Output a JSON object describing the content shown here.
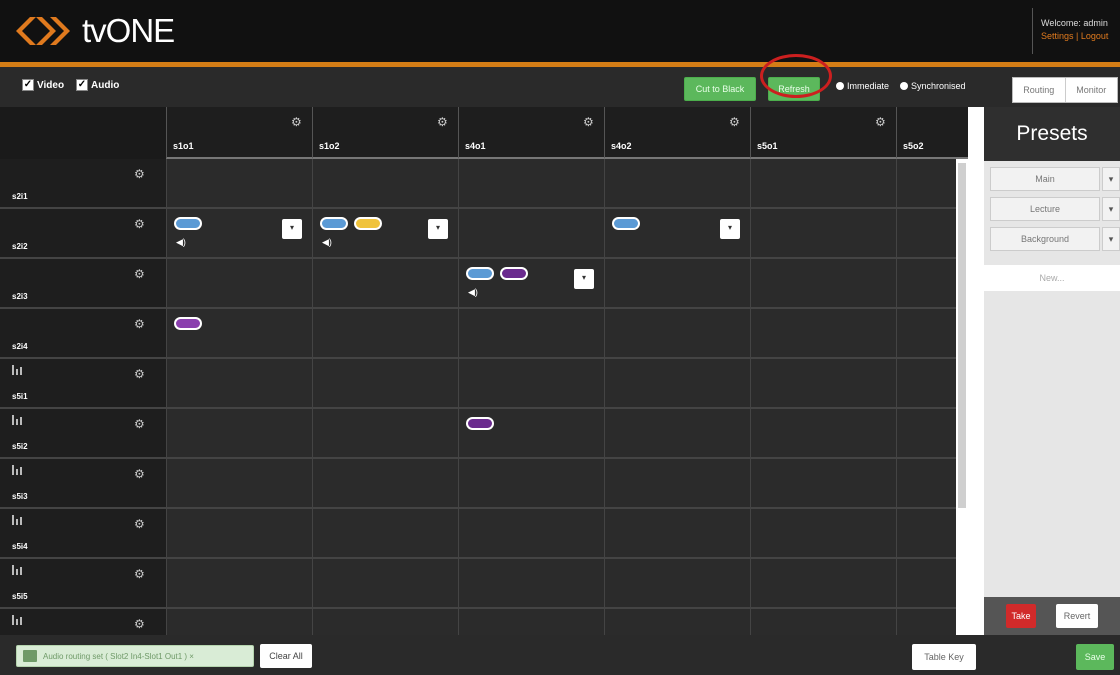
{
  "header": {
    "brand": "tvONE",
    "welcome": "Welcome: admin",
    "settings_link": "Settings",
    "separator": "|",
    "logout_link": "Logout"
  },
  "toolbar": {
    "video_label": "Video",
    "audio_label": "Audio",
    "cut_to_black": "Cut to Black",
    "refresh": "Refresh",
    "immediate": "Immediate",
    "synchronised": "Synchronised",
    "routing_tab": "Routing",
    "monitor_tab": "Monitor"
  },
  "grid": {
    "columns": [
      "s1o1",
      "s1o2",
      "s4o1",
      "s4o2",
      "s5o1",
      "s5o2"
    ],
    "rows": [
      "s2i1",
      "s2i2",
      "s2i3",
      "s2i4",
      "s5i1",
      "s5i2",
      "s5i3",
      "s5i4",
      "s5i5",
      ""
    ]
  },
  "presets": {
    "title": "Presets",
    "items": [
      "Main",
      "Lecture",
      "Background"
    ],
    "new_placeholder": "New...",
    "take": "Take",
    "revert": "Revert"
  },
  "footer": {
    "notice": "Audio routing set ( Slot2 In4-Slot1 Out1 )  ×",
    "clear_all": "Clear All",
    "table_key": "Table Key",
    "save": "Save"
  },
  "colors": {
    "accent": "#d47d16",
    "video_route": "#5b9ad5",
    "audio_route": "#f0c33c",
    "purple_route": "#8a3fae",
    "button_green": "#5cb85c",
    "take_red": "#d12a2a",
    "highlight_circle": "#cc1f1f"
  }
}
